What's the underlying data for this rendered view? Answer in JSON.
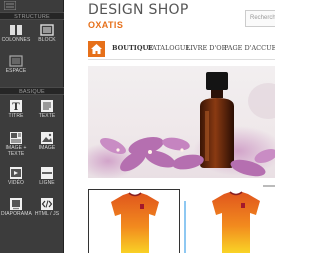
{
  "panel": {
    "sections": [
      {
        "title": "STRUCTURE"
      },
      {
        "title": "BASIQUE"
      }
    ],
    "structure_tools": [
      {
        "label": "COLONNES",
        "icon": "columns-icon"
      },
      {
        "label": "BLOCK",
        "icon": "block-icon"
      },
      {
        "label": "ESPACE",
        "icon": "space-icon"
      }
    ],
    "basic_tools": [
      {
        "label": "TITRE",
        "icon": "title-icon"
      },
      {
        "label": "TEXTE",
        "icon": "text-icon"
      },
      {
        "label": "IMAGE + TEXTE",
        "icon": "image-text-icon"
      },
      {
        "label": "IMAGE",
        "icon": "image-icon"
      },
      {
        "label": "VIDÉO",
        "icon": "video-icon"
      },
      {
        "label": "LIGNE",
        "icon": "line-icon"
      },
      {
        "label": "DIAPORAMA",
        "icon": "slideshow-icon"
      },
      {
        "label": "HTML / JS",
        "icon": "code-icon"
      }
    ]
  },
  "site": {
    "title": "DESIGN SHOP",
    "subtitle": "OXATIS",
    "search_placeholder": "Recherche",
    "nav": [
      "BOUTIQUE",
      "CATALOGUE",
      "LIVRE D'OR",
      "PAGE D'ACCUEIL"
    ],
    "accent_color": "#e6701a"
  }
}
